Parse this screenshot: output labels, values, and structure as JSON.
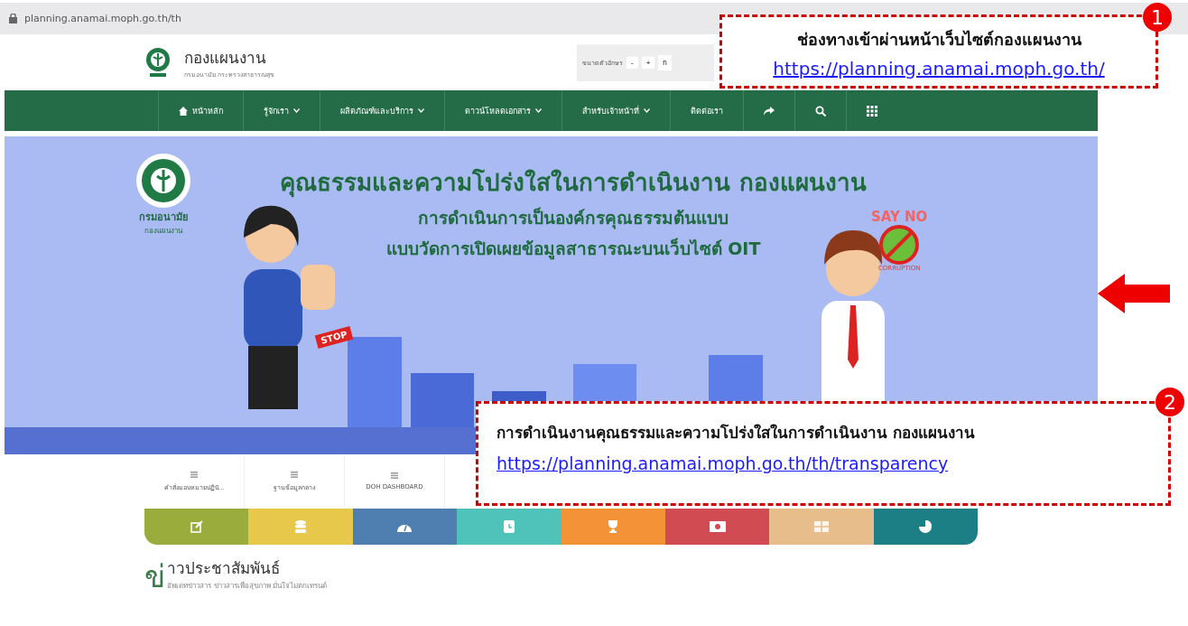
{
  "address_bar": {
    "url": "planning.anamai.moph.go.th/th"
  },
  "header": {
    "site_title": "กองแผนงาน",
    "site_subtitle": "กรมอนามัย กระทรวงสาธารณสุข",
    "font_label": "ขนาดตัวอักษร",
    "font_buttons": [
      "-",
      "+",
      "ก"
    ]
  },
  "nav": {
    "items": [
      {
        "label": "หน้าหลัก",
        "kind": "home"
      },
      {
        "label": "รู้จักเรา",
        "kind": "dropdown"
      },
      {
        "label": "ผลิตภัณฑ์และบริการ",
        "kind": "dropdown"
      },
      {
        "label": "ดาวน์โหลดเอกสาร",
        "kind": "dropdown"
      },
      {
        "label": "สำหรับเจ้าหน้าที่",
        "kind": "dropdown"
      },
      {
        "label": "ติดต่อเรา",
        "kind": "plain"
      },
      {
        "kind": "share"
      },
      {
        "kind": "search"
      },
      {
        "kind": "grid"
      }
    ]
  },
  "banner": {
    "title": "คุณธรรมและความโปร่งใสในการดำเนินงาน กองแผนงาน",
    "line_1": "การดำเนินการเป็นองค์กรคุณธรรมต้นแบบ",
    "line_2": "แบบวัดการเปิดเผยข้อมูลสาธารณะบนเว็บไซต์ OIT",
    "org_name": "กรมอนามัย",
    "org_sub": "กองแผนงาน",
    "say_no": "SAY NO",
    "corruption": "CORRUPTION",
    "stop": "STOP"
  },
  "quick_links": [
    {
      "label": "คำสั่งมอบหมายปฏิบั..."
    },
    {
      "label": "ฐานข้อมูลกลาง"
    },
    {
      "label": "DOH DASHBOARD"
    }
  ],
  "color_tabs": [
    {
      "color": "#9aac3c"
    },
    {
      "color": "#e8c84a"
    },
    {
      "color": "#4f7fb0"
    },
    {
      "color": "#4fc3b9"
    },
    {
      "color": "#f39237"
    },
    {
      "color": "#d14b53"
    },
    {
      "color": "#e8bd8c"
    },
    {
      "color": "#1c7f86"
    }
  ],
  "news": {
    "initial": "ข่",
    "title": "าวประชาสัมพันธ์",
    "subtitle": "อัพเดทข่าวสาร ข่าวสารเพื่อสุขภาพ มั่นใจไม่ตกเทรนด์"
  },
  "annotations": [
    {
      "number": "1",
      "title": "ช่องทางเข้าผ่านหน้าเว็บไซต์กองแผนงาน",
      "link": "https://planning.anamai.moph.go.th/"
    },
    {
      "number": "2",
      "title": "การดำเนินงานคุณธรรมและความโปร่งใสในการดำเนินงาน กองแผนงาน",
      "link": "https://planning.anamai.moph.go.th/th/transparency"
    }
  ]
}
